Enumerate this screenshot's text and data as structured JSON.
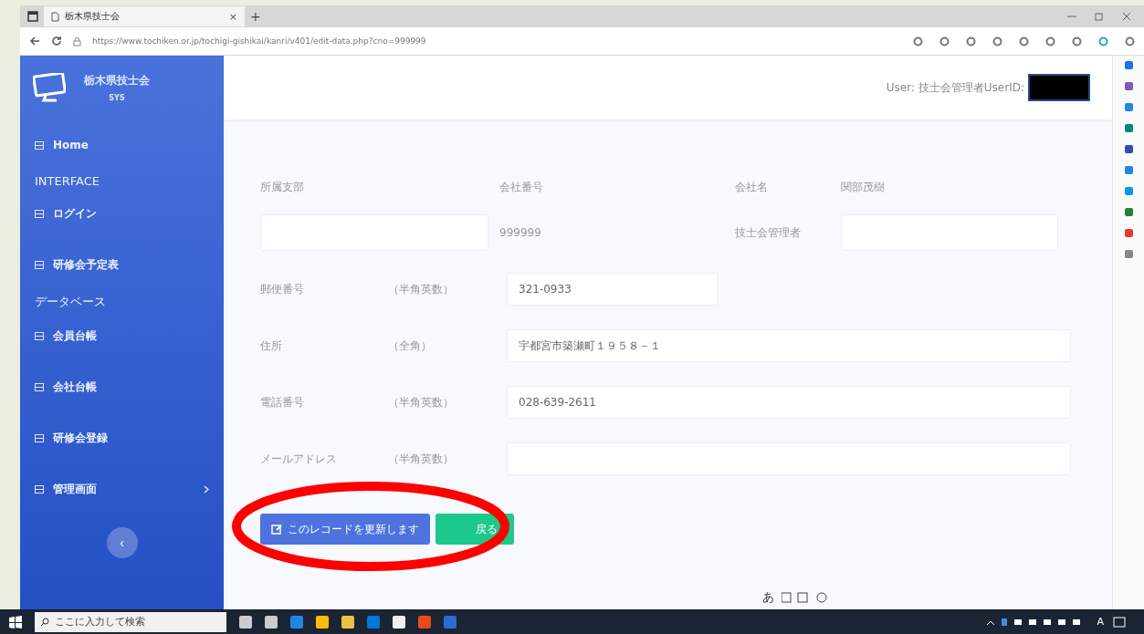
{
  "browser": {
    "tab_title": "栃木県技士会",
    "tab_close": "×",
    "new_tab": "+",
    "url": "https://www.tochiken.or.jp/tochigi-gishikai/kanri/v401/edit-data.php?cno=999999"
  },
  "sidebar": {
    "brand": "栃木県技士会",
    "brand_sub": "SYS",
    "items": [
      {
        "kind": "link",
        "label": "Home",
        "expandable": false
      },
      {
        "kind": "heading",
        "label": "INTERFACE"
      },
      {
        "kind": "link",
        "label": "ログイン",
        "expandable": false
      },
      {
        "kind": "link",
        "label": "研修会予定表",
        "expandable": false
      },
      {
        "kind": "heading",
        "label": "データベース"
      },
      {
        "kind": "link",
        "label": "会員台帳",
        "expandable": false
      },
      {
        "kind": "link",
        "label": "会社台帳",
        "expandable": false
      },
      {
        "kind": "link",
        "label": "研修会登録",
        "expandable": false
      },
      {
        "kind": "link",
        "label": "管理画面",
        "expandable": true
      }
    ],
    "toggle": "‹"
  },
  "header": {
    "user_text": "User: 技士会管理者UserID:"
  },
  "top_grid": [
    {
      "kind": "label",
      "text": "所属支部"
    },
    {
      "kind": "label",
      "text": "会社番号"
    },
    {
      "kind": "label",
      "text": "会社名"
    },
    {
      "kind": "text",
      "text": "関部茂樹"
    },
    {
      "kind": "input"
    },
    {
      "kind": "text",
      "text": "999999"
    },
    {
      "kind": "label",
      "text": "技士会管理者"
    },
    {
      "kind": "input"
    }
  ],
  "fields": [
    {
      "label": "郵便番号",
      "note": "（半角英数）",
      "value": "321-0933",
      "kind": "short"
    },
    {
      "label": "住所",
      "note": "（全角）",
      "value": "宇都宮市築瀬町１９５８－１",
      "kind": "wide"
    },
    {
      "label": "電話番号",
      "note": "（半角英数）",
      "value": "028-639-2611",
      "kind": "wide"
    },
    {
      "label": "メールアドレス",
      "note": "（半角英数）",
      "kind": "wide"
    }
  ],
  "buttons": [
    {
      "label": "このレコードを更新します",
      "kind": "primary"
    },
    {
      "label": "戻る",
      "kind": "success"
    }
  ],
  "taskbar": {
    "search_placeholder": "ここに入力して検索",
    "ime": "あ",
    "lang": "A"
  }
}
